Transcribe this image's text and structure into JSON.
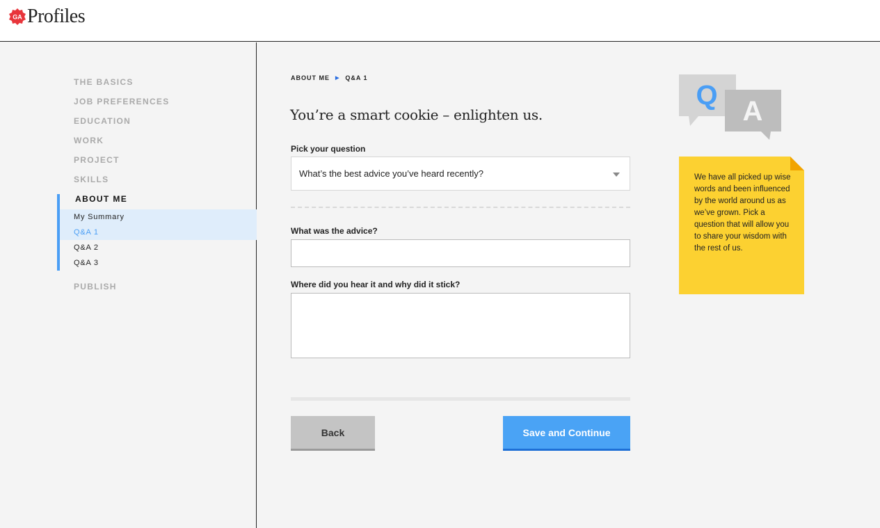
{
  "app": {
    "brand": "Profiles",
    "badge": "GA"
  },
  "sidebar": {
    "items": [
      {
        "label": "THE BASICS"
      },
      {
        "label": "JOB PREFERENCES"
      },
      {
        "label": "EDUCATION"
      },
      {
        "label": "WORK"
      },
      {
        "label": "PROJECT"
      },
      {
        "label": "SKILLS"
      }
    ],
    "active_section": {
      "label": "ABOUT ME",
      "subitems": [
        {
          "label": "My Summary"
        },
        {
          "label": "Q&A 1",
          "active": true
        },
        {
          "label": "Q&A 2"
        },
        {
          "label": "Q&A 3"
        }
      ]
    },
    "last_item": {
      "label": "PUBLISH"
    }
  },
  "breadcrumb": {
    "parent": "ABOUT ME",
    "separator": "▶",
    "current": "Q&A 1"
  },
  "main": {
    "title": "You’re a smart cookie – enlighten us.",
    "question_label": "Pick your question",
    "question_value": "What’s the best advice you’ve heard recently?",
    "advice_label": "What was the advice?",
    "advice_value": "",
    "where_label": "Where did you hear it and why did it stick?",
    "where_value": "",
    "back_label": "Back",
    "save_label": "Save and Continue"
  },
  "illustration": {
    "q": "Q",
    "a": "A"
  },
  "note": {
    "text": "We have all picked up wise words and been influenced by the world around us as we’ve grown. Pick a question that will allow you to share your wisdom with the rest of us."
  },
  "colors": {
    "accent": "#4aa3f5",
    "accent_dark": "#1e6fd6",
    "note_yellow": "#fcd131",
    "brand_red": "#e8353b"
  }
}
